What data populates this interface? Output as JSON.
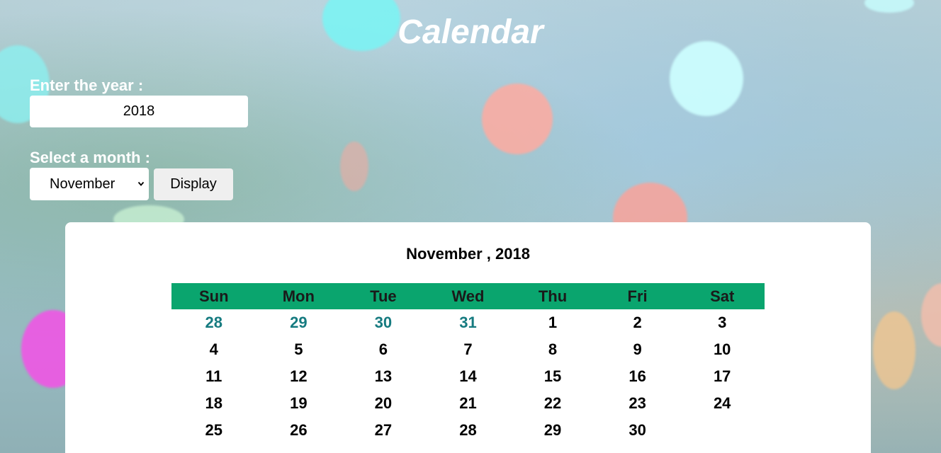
{
  "header": {
    "title": "Calendar"
  },
  "form": {
    "year_label": "Enter the year :",
    "year_value": "2018",
    "month_label": "Select a month :",
    "month_selected": "November",
    "display_button": "Display"
  },
  "calendar": {
    "heading": "November , 2018",
    "weekdays": [
      "Sun",
      "Mon",
      "Tue",
      "Wed",
      "Thu",
      "Fri",
      "Sat"
    ],
    "weeks": [
      [
        "28",
        "29",
        "30",
        "31",
        "1",
        "2",
        "3"
      ],
      [
        "4",
        "5",
        "6",
        "7",
        "8",
        "9",
        "10"
      ],
      [
        "11",
        "12",
        "13",
        "14",
        "15",
        "16",
        "17"
      ],
      [
        "18",
        "19",
        "20",
        "21",
        "22",
        "23",
        "24"
      ],
      [
        "25",
        "26",
        "27",
        "28",
        "29",
        "30",
        ""
      ]
    ],
    "colors": {
      "header_bg": "#0aa56e",
      "prev_month_text": "#167b80",
      "current_month_text": "#000000"
    }
  }
}
